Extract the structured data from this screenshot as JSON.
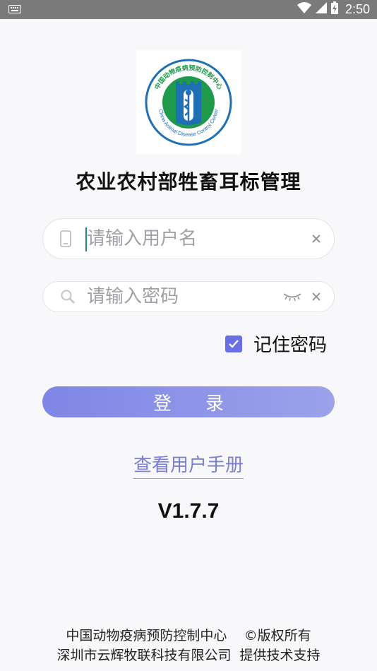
{
  "status_bar": {
    "time": "2:50",
    "icons": [
      "keyboard-icon",
      "wifi-icon",
      "signal-icon",
      "battery-charging-icon"
    ]
  },
  "logo": {
    "text_cn": "中国动物疫病预防控制中心",
    "text_en": "China Animal Disease Control Center"
  },
  "app": {
    "title": "农业农村部牲畜耳标管理"
  },
  "login_form": {
    "username_placeholder": "请输入用户名",
    "username_value": "",
    "password_placeholder": "请输入密码",
    "password_value": "",
    "remember_label": "记住密码",
    "remember_checked": true,
    "login_button": "登录"
  },
  "manual_link": "查看用户手册",
  "version": "V1.7.7",
  "footer": {
    "line1": "中国动物疫病预防控制中心    ©版权所有",
    "line2": "深圳市云辉牧联科技有限公司  提供技术支持"
  },
  "colors": {
    "accent": "#6b6fe6",
    "button_gradient_start": "#7f86e6",
    "button_gradient_end": "#9ba2ea",
    "logo_green": "#1e9a4a",
    "logo_blue": "#1f6fb5"
  }
}
